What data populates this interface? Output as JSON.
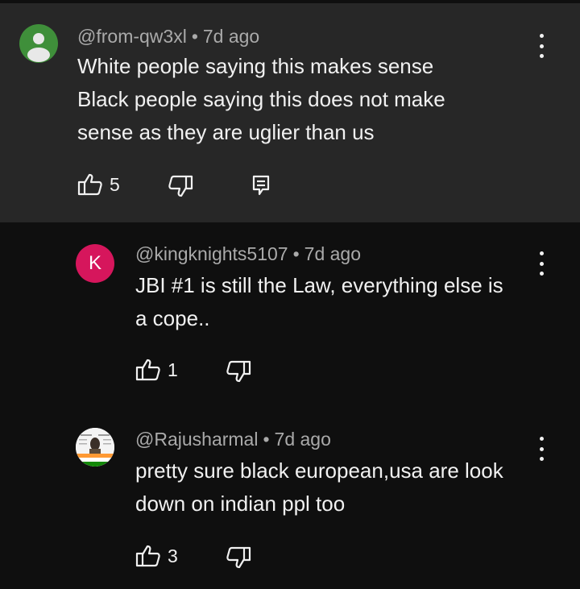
{
  "comments": [
    {
      "handle": "@from-qw3xl",
      "separator": "•",
      "time": "7d ago",
      "lines": [
        "White people saying this makes sense",
        "Black people saying this does not make",
        "sense as they are uglier than us"
      ],
      "likes": "5",
      "avatar_color": "#3f8f3a"
    },
    {
      "handle": "@kingknights5107",
      "separator": "•",
      "time": "7d ago",
      "lines": [
        "JBI #1 is still the Law, everything else is",
        "a cope.."
      ],
      "likes": "1",
      "avatar_letter": "K",
      "avatar_color": "#d6165c"
    },
    {
      "handle": "@Rajusharmal",
      "separator": "•",
      "time": "7d ago",
      "lines": [
        "pretty sure black european,usa are look",
        "down on indian ppl too"
      ],
      "likes": "3"
    }
  ],
  "icons": {
    "like": "thumbs-up-icon",
    "dislike": "thumbs-down-icon",
    "reply": "reply-icon",
    "menu": "more-vert-icon"
  }
}
